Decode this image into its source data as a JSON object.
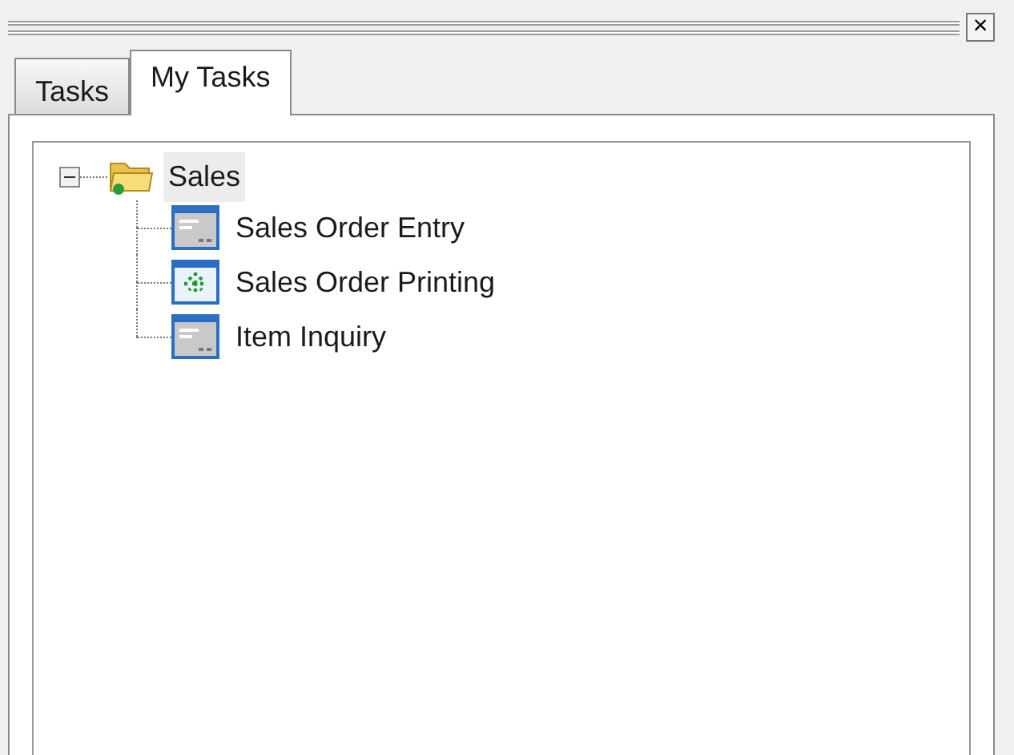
{
  "close_button": "×",
  "tabs": [
    {
      "label": "Tasks",
      "selected": false
    },
    {
      "label": "My Tasks",
      "selected": true
    }
  ],
  "tree": [
    {
      "label": "Sales",
      "kind": "folder",
      "expanded": true,
      "selected": true,
      "children": [
        {
          "label": "Sales Order Entry",
          "kind": "form",
          "selected": false
        },
        {
          "label": "Sales Order Printing",
          "kind": "process",
          "selected": false
        },
        {
          "label": "Item Inquiry",
          "kind": "form",
          "selected": false
        }
      ]
    }
  ]
}
